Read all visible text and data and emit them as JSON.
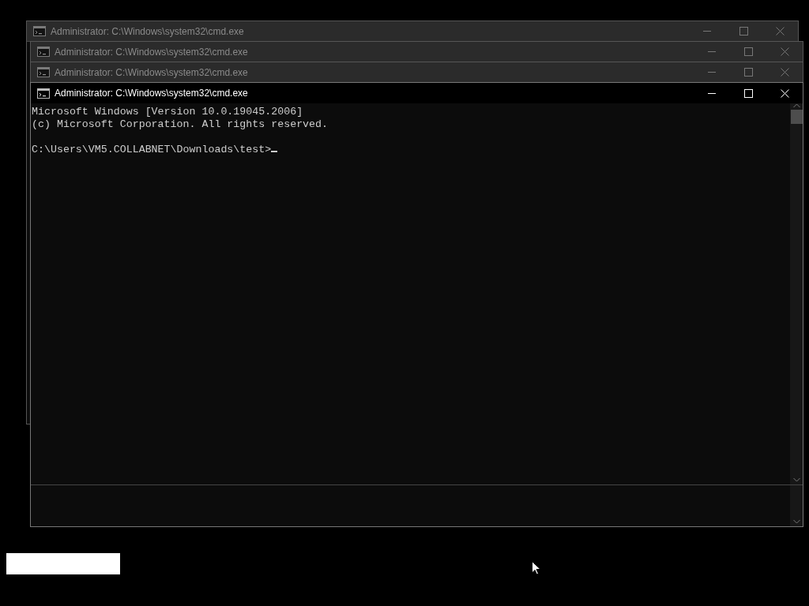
{
  "windows": [
    {
      "title": "Administrator: C:\\Windows\\system32\\cmd.exe",
      "active": false
    },
    {
      "title": "Administrator: C:\\Windows\\system32\\cmd.exe",
      "active": false
    },
    {
      "title": "Administrator: C:\\Windows\\system32\\cmd.exe",
      "active": false
    },
    {
      "title": "Administrator: C:\\Windows\\system32\\cmd.exe",
      "active": true,
      "console_blocks": [
        [
          "Microsoft Windows [Version 10.0.19045.2006]",
          "(c) Microsoft Corporation. All rights reserved."
        ],
        [
          "C:\\Users\\VM5.COLLABNET\\Downloads\\test>"
        ]
      ]
    }
  ]
}
